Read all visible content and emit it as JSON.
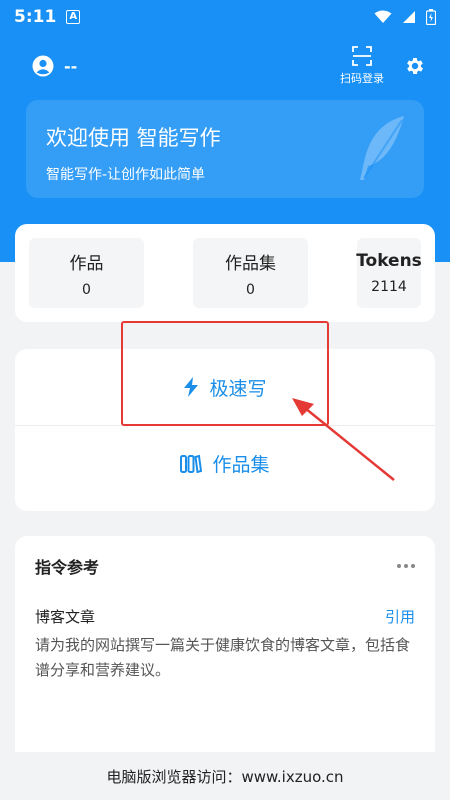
{
  "status_bar": {
    "time": "5:11",
    "notification_letter": "A",
    "icons": [
      "wifi-icon",
      "signal-icon",
      "battery-icon"
    ]
  },
  "header": {
    "user_name": "--",
    "scan_label": "扫码登录",
    "icons": [
      "user-icon",
      "scan-icon",
      "gear-icon"
    ]
  },
  "welcome": {
    "title": "欢迎使用 智能写作",
    "subtitle": "智能写作-让创作如此简单",
    "icon": "feather-icon"
  },
  "stats": [
    {
      "label": "作品",
      "value": "0"
    },
    {
      "label": "作品集",
      "value": "0"
    },
    {
      "label": "Tokens",
      "value": "2114"
    }
  ],
  "actions": {
    "fast_write": "极速写",
    "collection": "作品集"
  },
  "commands": {
    "title": "指令参考",
    "items": [
      {
        "name": "博客文章",
        "action": "引用",
        "description": "请为我的网站撰写一篇关于健康饮食的博客文章，包括食谱分享和营养建议。"
      }
    ]
  },
  "footer": {
    "text": "电脑版浏览器访问：www.ixzuo.cn"
  },
  "colors": {
    "primary": "#1890f5",
    "accent_text": "#1a8ee8",
    "highlight": "#e53935",
    "background": "#f2f3f5"
  }
}
